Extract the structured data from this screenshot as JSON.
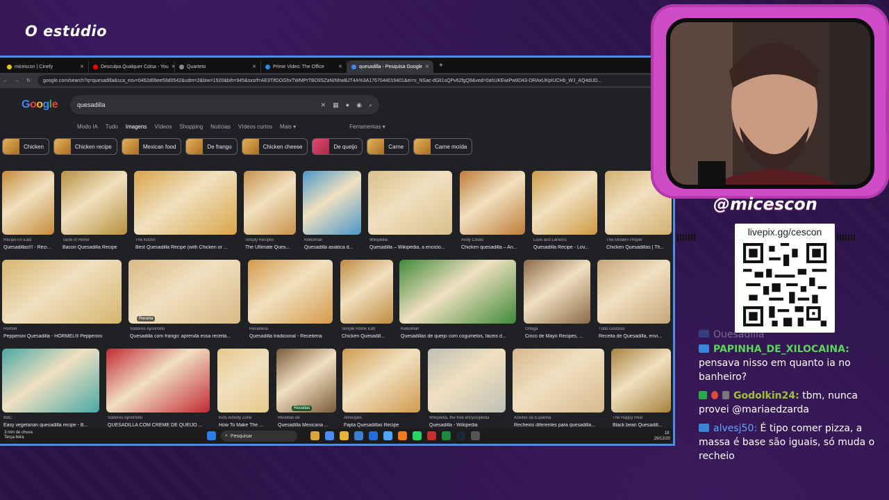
{
  "overlay": {
    "studio_title": "O estúdio",
    "streamer_handle": "@micescon",
    "donation_url": "livepix.gg/cescon"
  },
  "browser": {
    "tabs": [
      {
        "label": "micescon | Cinefy",
        "color": "#f4c20d",
        "active": false
      },
      {
        "label": "Desculpa Qualquer Coisa - You",
        "color": "#ff0000",
        "active": false
      },
      {
        "label": "Quarteto",
        "color": "#888888",
        "active": false
      },
      {
        "label": "Prime Video: The Office",
        "color": "#1f8ef1",
        "active": false
      },
      {
        "label": "quesadilla - Pesquisa Google",
        "color": "#4285f4",
        "active": true
      }
    ],
    "url": "google.com/search?q=quesadilla&sca_esv=0462d0bee59d0542&udm=2&biw=1920&bih=945&sxsrf=AE3TifOOGhxTWMPrTBOIlSZaNINhwBJT4A%3A1767044019401&ei=s_NSac-dGlI1sQPv62fgQ8&ved=0ahUKEwiPw9D43-ORAxUKpIUCHb_WJ_AQ4dUD..."
  },
  "google": {
    "logo": "Google",
    "query": "quesadilla",
    "nav": [
      "Modo IA",
      "Tudo",
      "Imagens",
      "Vídeos",
      "Shopping",
      "Notícias",
      "Vídeos curtos",
      "Mais ▾"
    ],
    "tools": "Ferramentas ▾",
    "chips": [
      "Chicken",
      "Chicken recipe",
      "Mexican food",
      "De frango",
      "Chicken cheese",
      "De queijo",
      "Carne",
      "Carne moída"
    ],
    "results": [
      {
        "source": "RecipeTin Eats",
        "title": "Quesadillas!!! - Reci...",
        "color": "#c68b3a"
      },
      {
        "source": "Taste of Home",
        "title": "Bacon Quesadilla Recipe",
        "color": "#b8903f"
      },
      {
        "source": "The Kitchn",
        "title": "Best Quesadilla Recipe (with Chicken or ...",
        "color": "#d9a54a"
      },
      {
        "source": "Simply Recipes",
        "title": "The Ultimate Ques...",
        "color": "#c9924a"
      },
      {
        "source": "Kikkoman",
        "title": "Quesadilla asiática d...",
        "color": "#4a98c9"
      },
      {
        "source": "Wikipédia",
        "title": "Quesadilla – Wikipédia, a enciclo...",
        "color": "#d8c08a"
      },
      {
        "source": "Andy Cooks",
        "title": "Chicken quesadilla – An...",
        "color": "#c07c38"
      },
      {
        "source": "Love and Lemons",
        "title": "Quesadilla Recipe - Lov...",
        "color": "#cf9a45"
      },
      {
        "source": "The Modern Proper",
        "title": "Chicken Quesadillas | Th...",
        "color": "#d3b070"
      },
      {
        "source": "Hormel",
        "title": "Pepperoni Quesadilla - HORMEL® Pepperoni",
        "color": "#d6b56e"
      },
      {
        "source": "Sabores Ajinomoto",
        "title": "Quesadilla com frango: aprenda essa receita...",
        "color": "#d9b985"
      },
      {
        "source": "Receiteria",
        "title": "Quesadilla tradicional - Receiteria",
        "color": "#d69a4a"
      },
      {
        "source": "Simple Home Edit",
        "title": "Chicken Quesadill...",
        "color": "#c08a3e"
      },
      {
        "source": "Kikkoman",
        "title": "Quesadillas de queijo com cogumelos, fáceis d...",
        "color": "#3f8a3a"
      },
      {
        "source": "Ortega",
        "title": "Cinco de Mayo Recipes, ...",
        "color": "#8c6a4a"
      },
      {
        "source": "Tudo Gostoso",
        "title": "Receita de Quesadilla, envi...",
        "color": "#c7a67a"
      },
      {
        "source": "BBC",
        "title": "Easy vegetarian quesadilla recipe - B...",
        "color": "#4aa8a6"
      },
      {
        "source": "Sabores Ajinomoto",
        "title": "QUESADILLA COM CREME DE QUEIJO ...",
        "color": "#c22a35"
      },
      {
        "source": "Kids Activity Zone",
        "title": "How To Make The ...",
        "color": "#e6c98a"
      },
      {
        "source": "Receitas de",
        "title": "Quesadilla Mexicana ...",
        "color": "#7a5a3a"
      },
      {
        "source": "Allrecipes",
        "title": "Fajita Quesadillas Recipe",
        "color": "#d19a4e"
      },
      {
        "source": "Wikipedia, the free encyclopedia",
        "title": "Quesadilla - Wikipedia",
        "color": "#bfbfb5"
      },
      {
        "source": "Azeites da Espanha",
        "title": "Recheios diferentes para quesadilla...",
        "color": "#d7b890"
      },
      {
        "source": "The Happy Pear",
        "title": "Black bean Quesadill...",
        "color": "#a8823d"
      }
    ],
    "overlay_labels": [
      "Receita",
      "Receitas"
    ]
  },
  "taskbar": {
    "weather_line1": "3 mm de chuva",
    "weather_line2": "Terça-feira",
    "search_placeholder": "Pesquisar",
    "time": "18:",
    "date": "29/12/20"
  },
  "chat": [
    {
      "user": "",
      "text": "Quesadilla",
      "faded": true
    },
    {
      "user": "PAPINHA_DE_XILOCAINA:",
      "text": "pensava nisso em quanto ia no banheiro?",
      "style": "green"
    },
    {
      "user": "Godolkin24:",
      "text": "tbm, nunca provei @mariaedzarda",
      "style": "olive"
    },
    {
      "user": "alvesj50:",
      "text": "É tipo comer pizza, a massa é base são iguais, só muda o recheio",
      "style": "blue"
    }
  ]
}
